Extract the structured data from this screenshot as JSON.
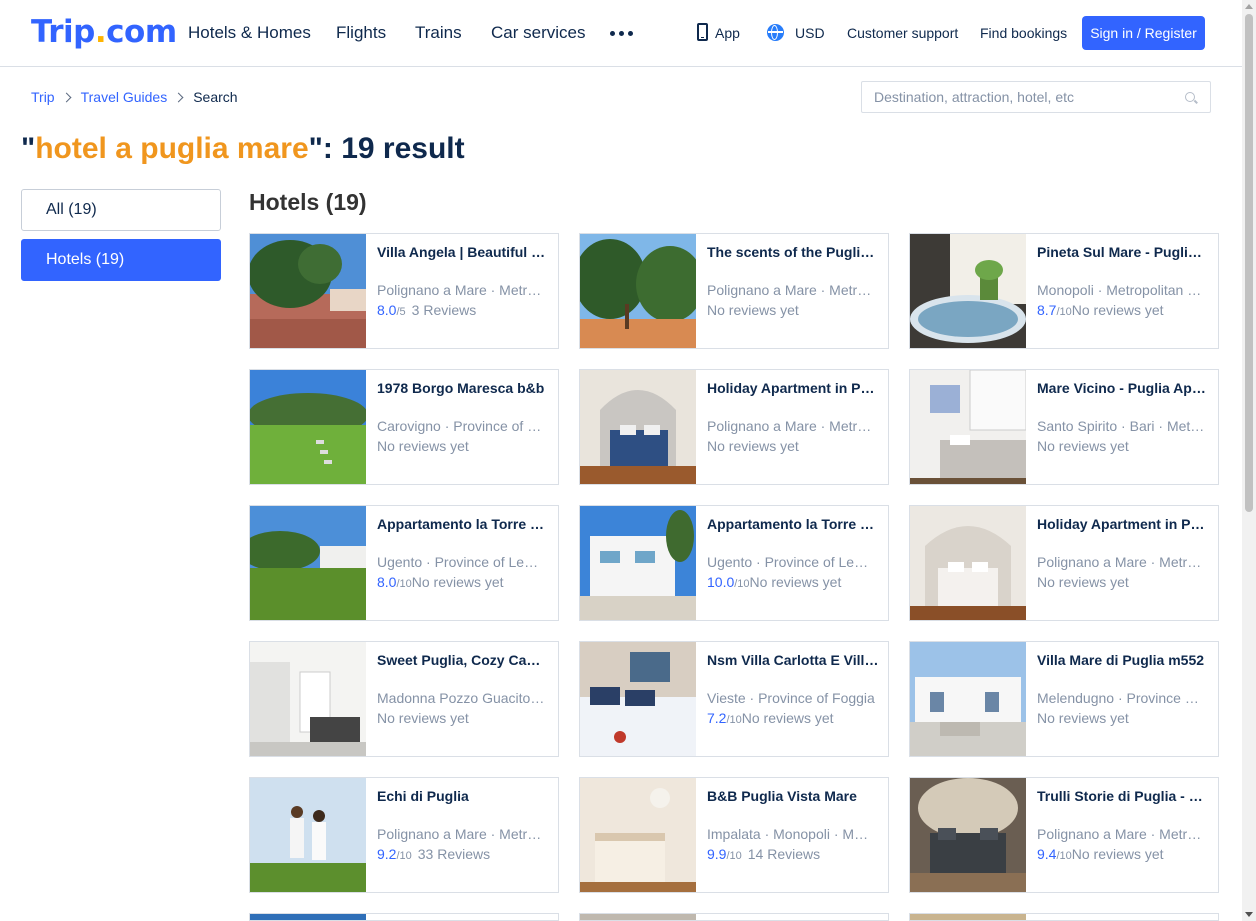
{
  "header": {
    "logo_main": "Trip",
    "logo_dot": ".",
    "logo_tld": "com",
    "nav": [
      "Hotels & Homes",
      "Flights",
      "Trains",
      "Car services"
    ],
    "app_label": "App",
    "currency": "USD",
    "support": "Customer support",
    "bookings": "Find bookings",
    "signin": "Sign in / Register"
  },
  "breadcrumb": [
    "Trip",
    "Travel Guides",
    "Search"
  ],
  "search": {
    "placeholder": "Destination, attraction, hotel, etc"
  },
  "title": {
    "open_quote": "\"",
    "keyword": "hotel a puglia mare",
    "close_suffix": "\": 19 result"
  },
  "filters": {
    "all": "All (19)",
    "hotels": "Hotels (19)"
  },
  "section_title": "Hotels (19)",
  "hotels": [
    {
      "name": "Villa Angela | Beautiful Villa in Polignano a Mare",
      "location": "Polignano a Mare · Metropolitan City of Bari",
      "score": "8.0",
      "scale": "/5",
      "reviews": "3 Reviews",
      "gap": true,
      "img": "villa"
    },
    {
      "name": "The scents of the Puglia countryside",
      "location": "Polignano a Mare · Metropolitan City of Bari",
      "score": "",
      "scale": "",
      "reviews": "No reviews yet",
      "gap": false,
      "img": "garden"
    },
    {
      "name": "Pineta Sul Mare - Puglia Apartment",
      "location": "Monopoli · Metropolitan City of Bari",
      "score": "8.7",
      "scale": "/10",
      "reviews": "No reviews yet",
      "gap": false,
      "img": "terrace"
    },
    {
      "name": "1978 Borgo Maresca b&b",
      "location": "Carovigno · Province of Brindisi",
      "score": "",
      "scale": "",
      "reviews": "No reviews yet",
      "gap": false,
      "img": "lawn"
    },
    {
      "name": "Holiday Apartment in Polignano a Mare",
      "location": "Polignano a Mare · Metropolitan City of Bari",
      "score": "",
      "scale": "",
      "reviews": "No reviews yet",
      "gap": false,
      "img": "bedroom-blue"
    },
    {
      "name": "Mare Vicino - Puglia Apartments",
      "location": "Santo Spirito · Bari · Metropolitan City of Bari",
      "score": "",
      "scale": "",
      "reviews": "No reviews yet",
      "gap": false,
      "img": "bedroom-white"
    },
    {
      "name": "Appartamento la Torre Salento Puglia",
      "location": "Ugento · Province of Lecce",
      "score": "8.0",
      "scale": "/10",
      "reviews": "No reviews yet",
      "gap": false,
      "img": "field"
    },
    {
      "name": "Appartamento la Torre Salento",
      "location": "Ugento · Province of Lecce",
      "score": "10.0",
      "scale": "/10",
      "reviews": "No reviews yet",
      "gap": false,
      "img": "building"
    },
    {
      "name": "Holiday Apartment in Polignano",
      "location": "Polignano a Mare · Metropolitan City of Bari",
      "score": "",
      "scale": "",
      "reviews": "No reviews yet",
      "gap": false,
      "img": "bedroom-arch"
    },
    {
      "name": "Sweet Puglia, Cozy Campagna",
      "location": "Madonna Pozzo Guacito · Monopoli",
      "score": "",
      "scale": "",
      "reviews": "No reviews yet",
      "gap": false,
      "img": "interior"
    },
    {
      "name": "Nsm Villa Carlotta E Villa Mare",
      "location": "Vieste · Province of Foggia",
      "score": "7.2",
      "scale": "/10",
      "reviews": "No reviews yet",
      "gap": false,
      "img": "bed-pillows"
    },
    {
      "name": "Villa Mare di Puglia m552",
      "location": "Melendugno · Province of Lecce",
      "score": "",
      "scale": "",
      "reviews": "No reviews yet",
      "gap": false,
      "img": "white-house"
    },
    {
      "name": "Echi di Puglia",
      "location": "Polignano a Mare · Metropolitan City of Bari",
      "score": "9.2",
      "scale": "/10",
      "reviews": "33 Reviews",
      "gap": true,
      "img": "dancers"
    },
    {
      "name": "B&B Puglia Vista Mare",
      "location": "Impalata · Monopoli · Metropolitan City of Bari",
      "score": "9.9",
      "scale": "/10",
      "reviews": "14 Reviews",
      "gap": true,
      "img": "bb-room"
    },
    {
      "name": "Trulli Storie di Puglia - Trullo",
      "location": "Polignano a Mare · Metropolitan City of Bari",
      "score": "9.4",
      "scale": "/10",
      "reviews": "No reviews yet",
      "gap": false,
      "img": "trullo"
    }
  ],
  "colors": {
    "brand": "#3264ff",
    "keyword": "#f0961e",
    "text": "#0f294d",
    "muted": "#8592a6"
  }
}
